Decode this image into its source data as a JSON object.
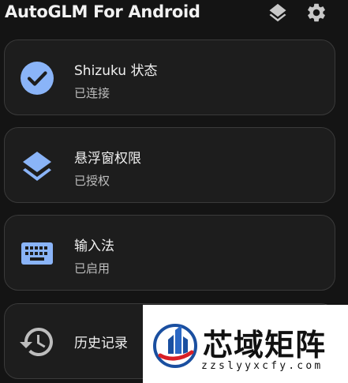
{
  "app": {
    "title": "AutoGLM For Android"
  },
  "toolbar": {
    "icons": [
      "layers-icon",
      "settings-gear-icon"
    ]
  },
  "permissions": [
    {
      "title": "Shizuku 状态",
      "status": "已连接",
      "icon": "check-circle-icon"
    },
    {
      "title": "悬浮窗权限",
      "status": "已授权",
      "icon": "layers-icon"
    },
    {
      "title": "输入法",
      "status": "已启用",
      "icon": "keyboard-icon"
    },
    {
      "title": "历史记录",
      "icon": "history-icon"
    }
  ],
  "watermark": {
    "title": "芯域矩阵",
    "domain": "zzslyyxcfy.com"
  },
  "colors": {
    "background": "#141414",
    "card": "#1d1d1d",
    "accent": "#8ab4f8",
    "icon_gray": "#bdbdbd"
  }
}
